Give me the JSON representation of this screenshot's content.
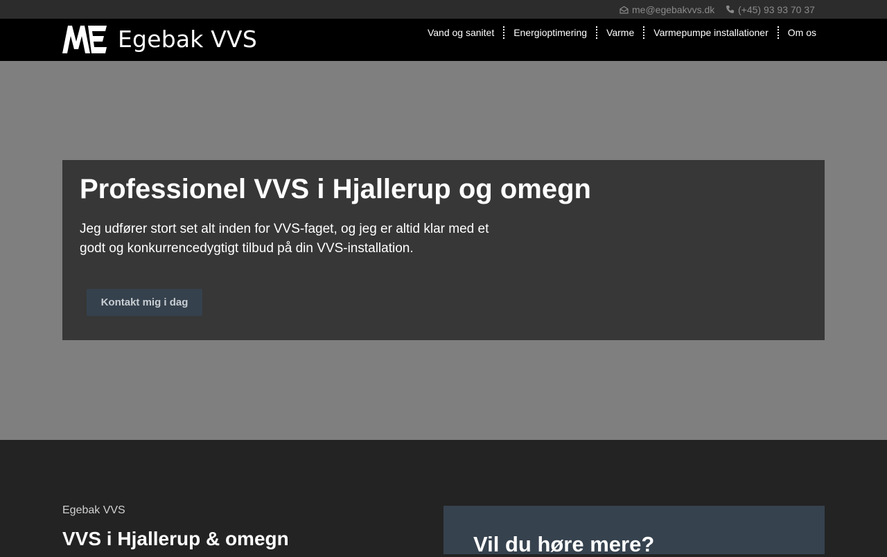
{
  "topbar": {
    "email": "me@egebakvvs.dk",
    "email_icon": "envelope-icon",
    "phone": "(+45) 93 93 70 37",
    "phone_icon": "phone-icon"
  },
  "header": {
    "logo_mark": "ME",
    "logo_text": "Egebak VVS",
    "nav": [
      {
        "label": "Vand og sanitet"
      },
      {
        "label": "Energioptimering"
      },
      {
        "label": "Varme"
      },
      {
        "label": "Varmepumpe installationer"
      },
      {
        "label": "Om os"
      }
    ]
  },
  "hero": {
    "title": "Professionel VVS i Hjallerup og omegn",
    "text": "Jeg udfører stort set alt inden for VVS-faget, og jeg er altid klar med et godt og konkurrencedygtigt tilbud på din VVS-installation.",
    "button": "Kontakt mig i dag"
  },
  "about": {
    "eyebrow": "Egebak VVS",
    "title": "VVS i Hjallerup & omegn"
  },
  "cta": {
    "title": "Vil du høre mere?"
  },
  "colors": {
    "hero_bg": "#7f7f7f",
    "hero_box": "#373737",
    "accent_button": "#35414d",
    "card": "#36424e"
  }
}
